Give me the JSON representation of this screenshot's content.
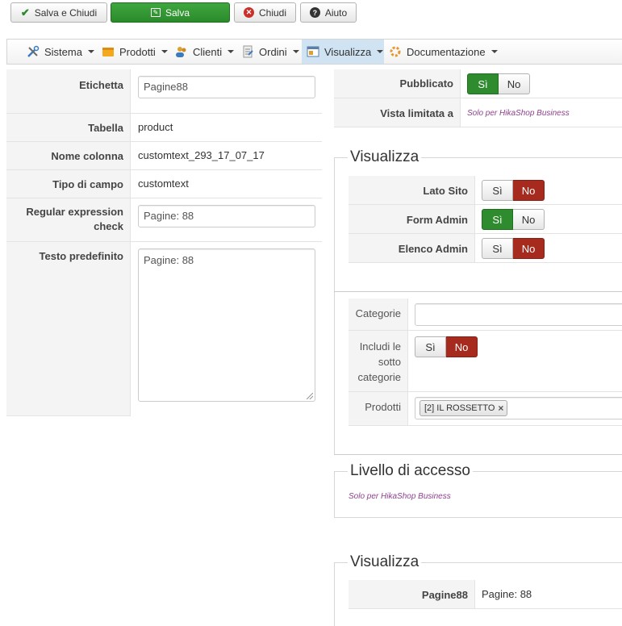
{
  "toolbar": {
    "save_close": "Salva e Chiudi",
    "save": "Salva",
    "close": "Chiudi",
    "help": "Aiuto"
  },
  "menu": {
    "items": [
      {
        "label": "Sistema",
        "icon": "tools-icon"
      },
      {
        "label": "Prodotti",
        "icon": "products-icon"
      },
      {
        "label": "Clienti",
        "icon": "customers-icon"
      },
      {
        "label": "Ordini",
        "icon": "orders-icon"
      },
      {
        "label": "Visualizza",
        "icon": "display-icon",
        "active": true
      },
      {
        "label": "Documentazione",
        "icon": "documentation-icon"
      }
    ]
  },
  "left_form": {
    "label_label": "Etichetta",
    "label_value": "Pagine88",
    "table_label": "Tabella",
    "table_value": "product",
    "column_label": "Nome colonna",
    "column_value": "customtext_293_17_07_17",
    "fieldtype_label": "Tipo di campo",
    "fieldtype_value": "customtext",
    "regex_label": "Regular expression check",
    "regex_value": "Pagine: 88",
    "default_label": "Testo predefinito",
    "default_value": "Pagine: 88"
  },
  "right_top": {
    "published_label": "Pubblicato",
    "published_yes": "Sì",
    "published_no": "No",
    "published_value": "Sì",
    "limited_label": "Vista limitata a",
    "limited_note": "Solo per HikaShop Business"
  },
  "display_section": {
    "legend": "Visualizza",
    "rows": [
      {
        "label": "Lato Sito",
        "yes": "Sì",
        "no": "No",
        "value": "No"
      },
      {
        "label": "Form Admin",
        "yes": "Sì",
        "no": "No",
        "value": "Sì"
      },
      {
        "label": "Elenco Admin",
        "yes": "Sì",
        "no": "No",
        "value": "No"
      }
    ]
  },
  "categories_section": {
    "categories_label": "Categorie",
    "categories_value": "",
    "include_sub_label": "Includi le sotto categorie",
    "include_yes": "Sì",
    "include_no": "No",
    "include_value": "No",
    "products_label": "Prodotti",
    "product_tag": "[2] IL ROSSETTO",
    "product_tag_remove": "×"
  },
  "access_section": {
    "legend": "Livello di accesso",
    "note": "Solo per HikaShop Business"
  },
  "preview_section": {
    "legend": "Visualizza",
    "label": "Pagine88",
    "value": "Pagine: 88"
  },
  "colors": {
    "green": "#2e8b2e",
    "red": "#a72a1e",
    "accent_menu": "#cfe3f3",
    "note_purple": "#8e3f8e"
  }
}
